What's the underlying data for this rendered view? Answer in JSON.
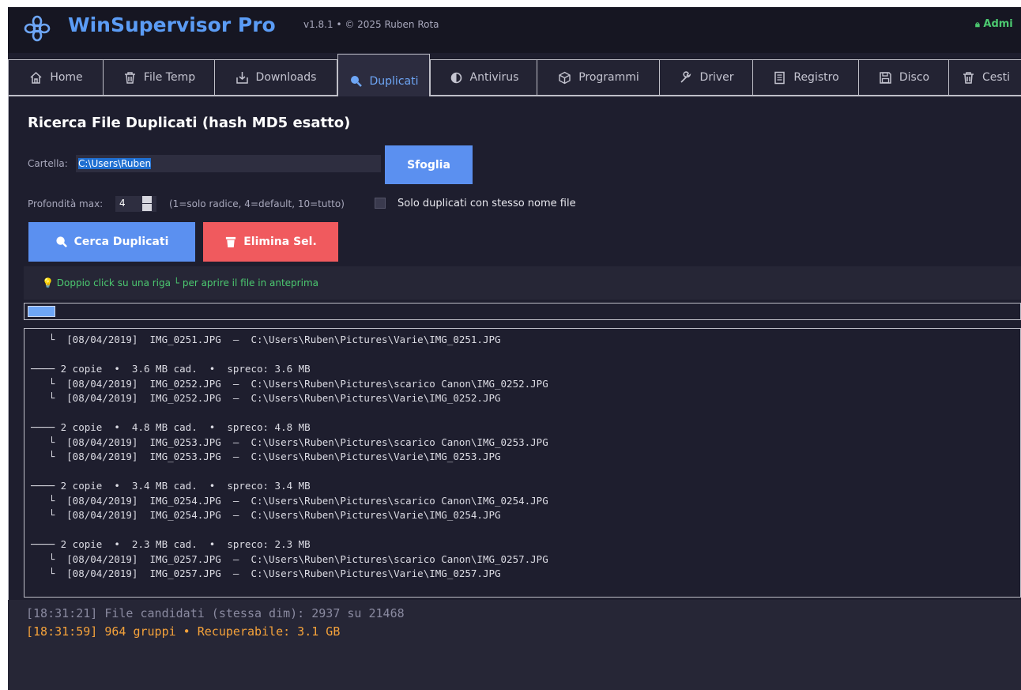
{
  "header": {
    "app_name": "WinSupervisor Pro",
    "version": "v1.8.1 • © 2025 Ruben Rota",
    "admin_label": "Admi",
    "logo_icon": "gear-flower-icon"
  },
  "tabs": [
    {
      "label": "Home",
      "icon": "home-icon"
    },
    {
      "label": "File Temp",
      "icon": "trash-icon"
    },
    {
      "label": "Downloads",
      "icon": "download-tray-icon"
    },
    {
      "label": "Duplicati",
      "icon": "search-icon",
      "active": true
    },
    {
      "label": "Antivirus",
      "icon": "half-circle-icon"
    },
    {
      "label": "Programmi",
      "icon": "package-icon"
    },
    {
      "label": "Driver",
      "icon": "wrench-icon"
    },
    {
      "label": "Registro",
      "icon": "document-icon"
    },
    {
      "label": "Disco",
      "icon": "floppy-disk-icon"
    },
    {
      "label": "Cesti",
      "icon": "trash-icon"
    }
  ],
  "duplicates": {
    "title": "Ricerca File Duplicati (hash MD5 esatto)",
    "folder_label": "Cartella:",
    "folder_value": "C:\\Users\\Ruben",
    "browse_label": "Sfoglia",
    "depth_label": "Profondità max:",
    "depth_value": "4",
    "depth_hint": "(1=solo radice, 4=default, 10=tutto)",
    "same_name_label": "Solo duplicati con stesso nome file",
    "same_name_checked": false,
    "search_label": "Cerca Duplicati",
    "delete_label": "Elimina Sel.",
    "tip": "💡 Doppio click su una riga └ per aprire il file in anteprima",
    "progress_fraction": 0.028,
    "results_text": "   └  [08/04/2019]  IMG_0251.JPG  —  C:\\Users\\Ruben\\Pictures\\Varie\\IMG_0251.JPG\n\n──── 2 copie  •  3.6 MB cad.  •  spreco: 3.6 MB\n   └  [08/04/2019]  IMG_0252.JPG  —  C:\\Users\\Ruben\\Pictures\\scarico Canon\\IMG_0252.JPG\n   └  [08/04/2019]  IMG_0252.JPG  —  C:\\Users\\Ruben\\Pictures\\Varie\\IMG_0252.JPG\n\n──── 2 copie  •  4.8 MB cad.  •  spreco: 4.8 MB\n   └  [08/04/2019]  IMG_0253.JPG  —  C:\\Users\\Ruben\\Pictures\\scarico Canon\\IMG_0253.JPG\n   └  [08/04/2019]  IMG_0253.JPG  —  C:\\Users\\Ruben\\Pictures\\Varie\\IMG_0253.JPG\n\n──── 2 copie  •  3.4 MB cad.  •  spreco: 3.4 MB\n   └  [08/04/2019]  IMG_0254.JPG  —  C:\\Users\\Ruben\\Pictures\\scarico Canon\\IMG_0254.JPG\n   └  [08/04/2019]  IMG_0254.JPG  —  C:\\Users\\Ruben\\Pictures\\Varie\\IMG_0254.JPG\n\n──── 2 copie  •  2.3 MB cad.  •  spreco: 2.3 MB\n   └  [08/04/2019]  IMG_0257.JPG  —  C:\\Users\\Ruben\\Pictures\\scarico Canon\\IMG_0257.JPG\n   └  [08/04/2019]  IMG_0257.JPG  —  C:\\Users\\Ruben\\Pictures\\Varie\\IMG_0257.JPG"
  },
  "log": [
    "[18:31:21]  File candidati (stessa dim): 2937 su 21468",
    "[18:31:59]  964 gruppi  •  Recuperabile: 3.1 GB"
  ],
  "colors": {
    "accent": "#5b90f0",
    "danger": "#f05a5e",
    "success": "#4cc970",
    "warning": "#f5a23a"
  }
}
